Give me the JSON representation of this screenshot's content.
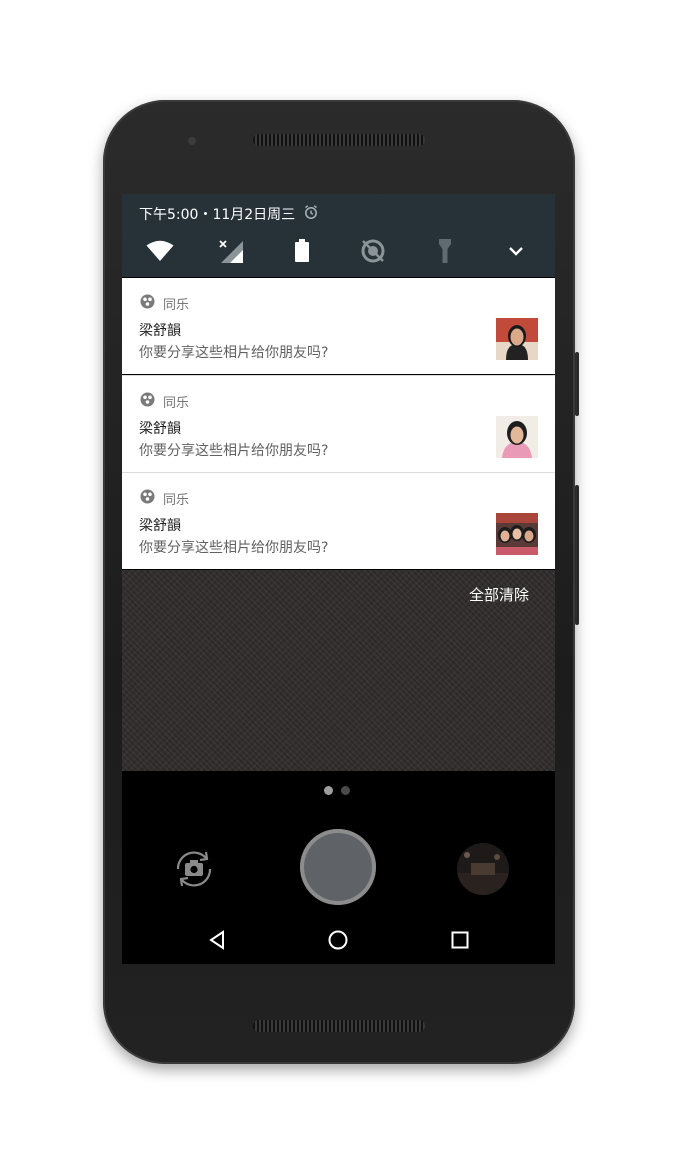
{
  "status": {
    "time_date": "下午5:00・11月2日周三",
    "alarm_icon": "alarm-clock-icon"
  },
  "quick_settings": {
    "icons": [
      "wifi-icon",
      "mobile-signal-off-icon",
      "battery-icon",
      "data-saver-off-icon",
      "flashlight-icon",
      "chevron-down-icon"
    ]
  },
  "notifications": [
    {
      "app": "同乐",
      "title": "梁舒韻",
      "text": "你要分享这些相片给你朋友吗?"
    },
    {
      "app": "同乐",
      "title": "梁舒韻",
      "text": "你要分享这些相片给你朋友吗?"
    },
    {
      "app": "同乐",
      "title": "梁舒韻",
      "text": "你要分享这些相片给你朋友吗?"
    }
  ],
  "clear_all": "全部清除",
  "camera": {
    "pager_active_index": 0,
    "pager_count": 2
  },
  "colors": {
    "qs_background": "#263238",
    "notification_bg": "#ffffff",
    "shutter": "#5f6368"
  }
}
